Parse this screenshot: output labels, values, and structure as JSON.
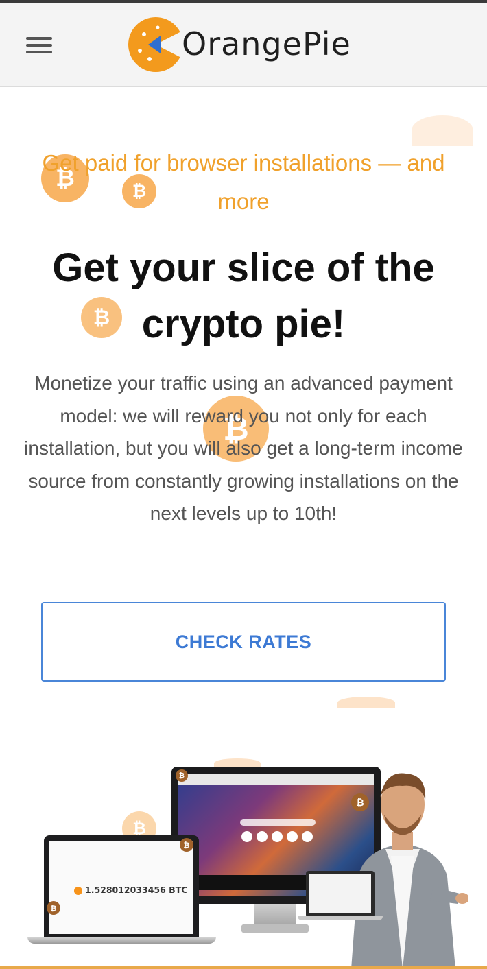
{
  "header": {
    "brand": "OrangePie",
    "menu_icon": "hamburger-menu-icon",
    "logo_icon": "orangepie-logo-icon"
  },
  "hero": {
    "tagline": "Get paid for browser installations — and more",
    "headline": "Get your slice of the crypto pie!",
    "description": "Monetize your traffic using an advanced payment model: we will reward you not only for each installation, but you will also get a long-term income source from constantly growing installations on the next levels up to 10th!",
    "cta_label": "CHECK RATES"
  },
  "illustration": {
    "btc_balance": "1.528012033456 BTC"
  },
  "colors": {
    "accent_orange": "#f0a12c",
    "coin_orange": "#f7a84a",
    "cta_blue": "#3d7ad4",
    "headline": "#111111"
  }
}
